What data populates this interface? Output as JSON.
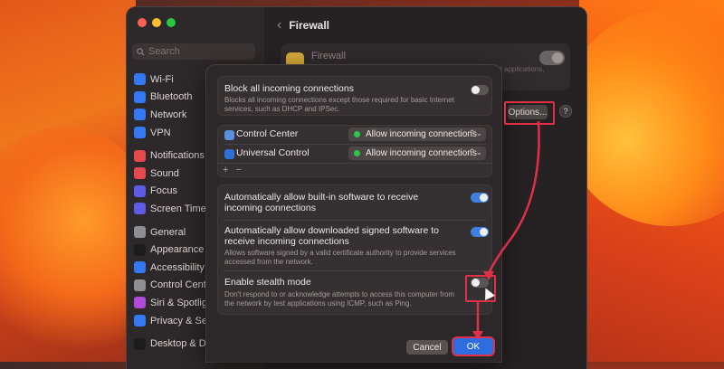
{
  "sidebar": {
    "search_placeholder": "Search",
    "items": [
      {
        "label": "Wi-Fi",
        "icon": "wifi-icon",
        "color": "#3478f6"
      },
      {
        "label": "Bluetooth",
        "icon": "bluetooth-icon",
        "color": "#3478f6"
      },
      {
        "label": "Network",
        "icon": "network-icon",
        "color": "#3478f6"
      },
      {
        "label": "VPN",
        "icon": "vpn-icon",
        "color": "#3478f6"
      },
      {
        "label": "Notifications",
        "icon": "notifications-icon",
        "color": "#e5484d"
      },
      {
        "label": "Sound",
        "icon": "sound-icon",
        "color": "#e5484d"
      },
      {
        "label": "Focus",
        "icon": "focus-icon",
        "color": "#5e5ce6"
      },
      {
        "label": "Screen Time",
        "icon": "screen-time-icon",
        "color": "#5e5ce6"
      },
      {
        "label": "General",
        "icon": "gear-icon",
        "color": "#8e8e93"
      },
      {
        "label": "Appearance",
        "icon": "appearance-icon",
        "color": "#1c1c1e"
      },
      {
        "label": "Accessibility",
        "icon": "accessibility-icon",
        "color": "#3478f6"
      },
      {
        "label": "Control Center",
        "icon": "control-center-icon",
        "color": "#8e8e93"
      },
      {
        "label": "Siri & Spotlight",
        "icon": "siri-icon",
        "color": "#b04bd8"
      },
      {
        "label": "Privacy & Security",
        "icon": "privacy-icon",
        "color": "#3478f6"
      },
      {
        "label": "Desktop & Dock",
        "icon": "desktop-dock-icon",
        "color": "#1c1c1e"
      }
    ]
  },
  "header": {
    "title": "Firewall"
  },
  "firewall_card": {
    "title": "Firewall",
    "description": "The firewall is turned on and set up to prevent unauthorized applications, programs, and services from accepting incoming"
  },
  "options_label": "Options...",
  "help_label": "?",
  "dialog": {
    "block_all": {
      "title": "Block all incoming connections",
      "desc": "Blocks all incoming connections except those required for basic Internet services, such as DHCP and IPSec."
    },
    "apps": [
      {
        "name": "Control Center",
        "status": "Allow incoming connections"
      },
      {
        "name": "Universal Control",
        "status": "Allow incoming connections"
      }
    ],
    "add_label": "+",
    "remove_label": "−",
    "auto_builtin": {
      "title": "Automatically allow built-in software to receive incoming connections"
    },
    "auto_signed": {
      "title": "Automatically allow downloaded signed software to receive incoming connections",
      "desc": "Allows software signed by a valid certificate authority to provide services accessed from the network."
    },
    "stealth": {
      "title": "Enable stealth mode",
      "desc": "Don't respond to or acknowledge attempts to access this computer from the network by test applications using ICMP, such as Ping."
    },
    "cancel_label": "Cancel",
    "ok_label": "OK"
  },
  "colors": {
    "accent": "#3f7fe0",
    "highlight": "#e03048",
    "allow_dot": "#2fc54a"
  }
}
